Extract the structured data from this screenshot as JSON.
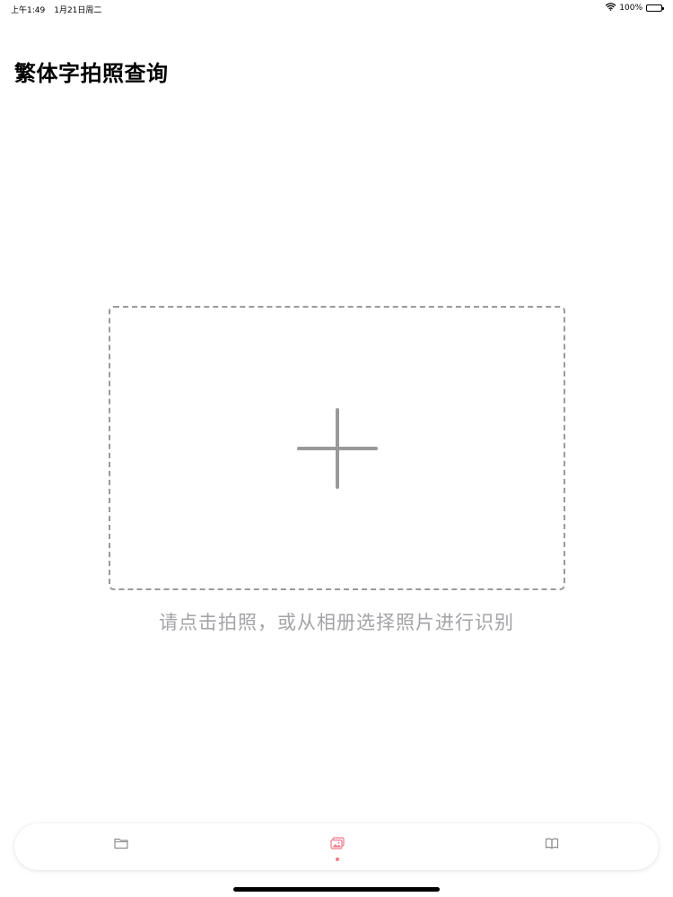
{
  "status_bar": {
    "time": "上午1:49",
    "date": "1月21日周二",
    "battery": "100%"
  },
  "page": {
    "title": "繁体字拍照查询"
  },
  "upload": {
    "hint": "请点击拍照，或从相册选择照片进行识别",
    "icon": "plus-icon"
  },
  "tabs": [
    {
      "icon": "folder-icon",
      "active": false
    },
    {
      "icon": "photo-icon",
      "active": true
    },
    {
      "icon": "book-icon",
      "active": false
    }
  ],
  "colors": {
    "accent": "#f07a8c",
    "inactive_icon": "#8e8e93",
    "dashed_border": "#9a9a9a",
    "hint_text": "#a3a3a8"
  }
}
